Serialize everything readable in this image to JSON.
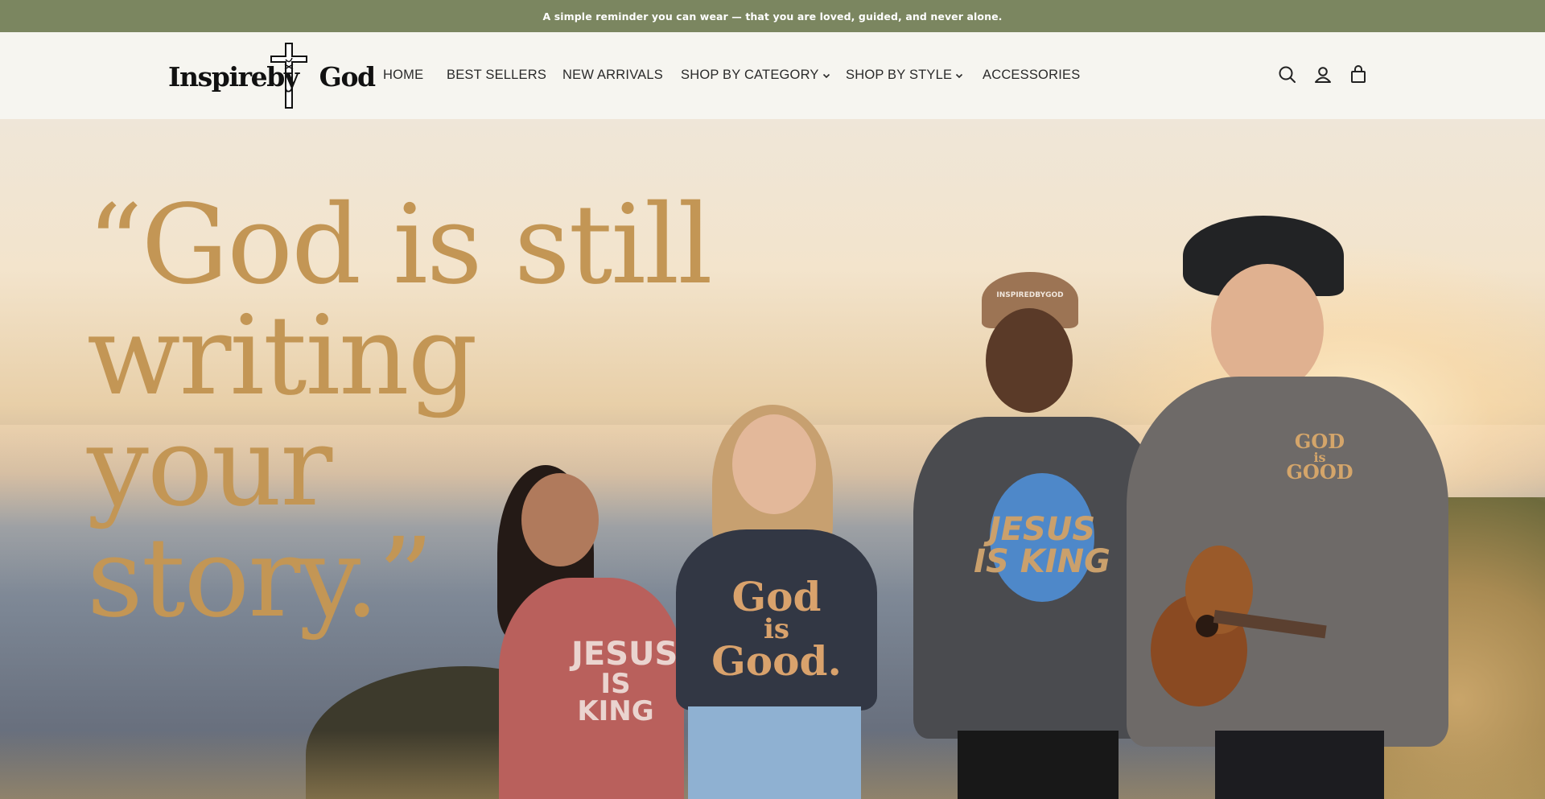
{
  "announcement": {
    "text": "A simple reminder you can wear — that you are loved, guided, and never alone."
  },
  "brand": {
    "part1": "Inspireby",
    "part2": "God"
  },
  "nav": {
    "items": [
      {
        "label": "HOME",
        "has_dropdown": false
      },
      {
        "label": "BEST SELLERS",
        "has_dropdown": false
      },
      {
        "label": "NEW ARRIVALS",
        "has_dropdown": false
      },
      {
        "label": "SHOP BY CATEGORY",
        "has_dropdown": true
      },
      {
        "label": "SHOP BY STYLE",
        "has_dropdown": true
      },
      {
        "label": "ACCESSORIES",
        "has_dropdown": false
      }
    ]
  },
  "header_icons": [
    "search-icon",
    "account-icon",
    "cart-icon"
  ],
  "hero": {
    "quote_line1": "“God is still",
    "quote_line2": "writing your",
    "quote_line3": "story.”",
    "shirt_prints": {
      "hoodie_left_line1": "JESUS",
      "hoodie_left_line2": "IS KING",
      "tee_center_line1": "God",
      "tee_center_line2": "is",
      "tee_center_line3": "Good.",
      "tee_lion_line1": "JESUS",
      "tee_lion_line2": "IS KING",
      "hoodie_right_line1": "GOD",
      "hoodie_right_line2": "is",
      "hoodie_right_line3": "GOOD",
      "cap_text": "INSPIREDBYGOD"
    }
  },
  "colors": {
    "announcement_bg": "#7b8660",
    "header_bg": "#f6f5f0",
    "quote_gold": "#c39655",
    "text_dark": "#2a2a2a"
  }
}
